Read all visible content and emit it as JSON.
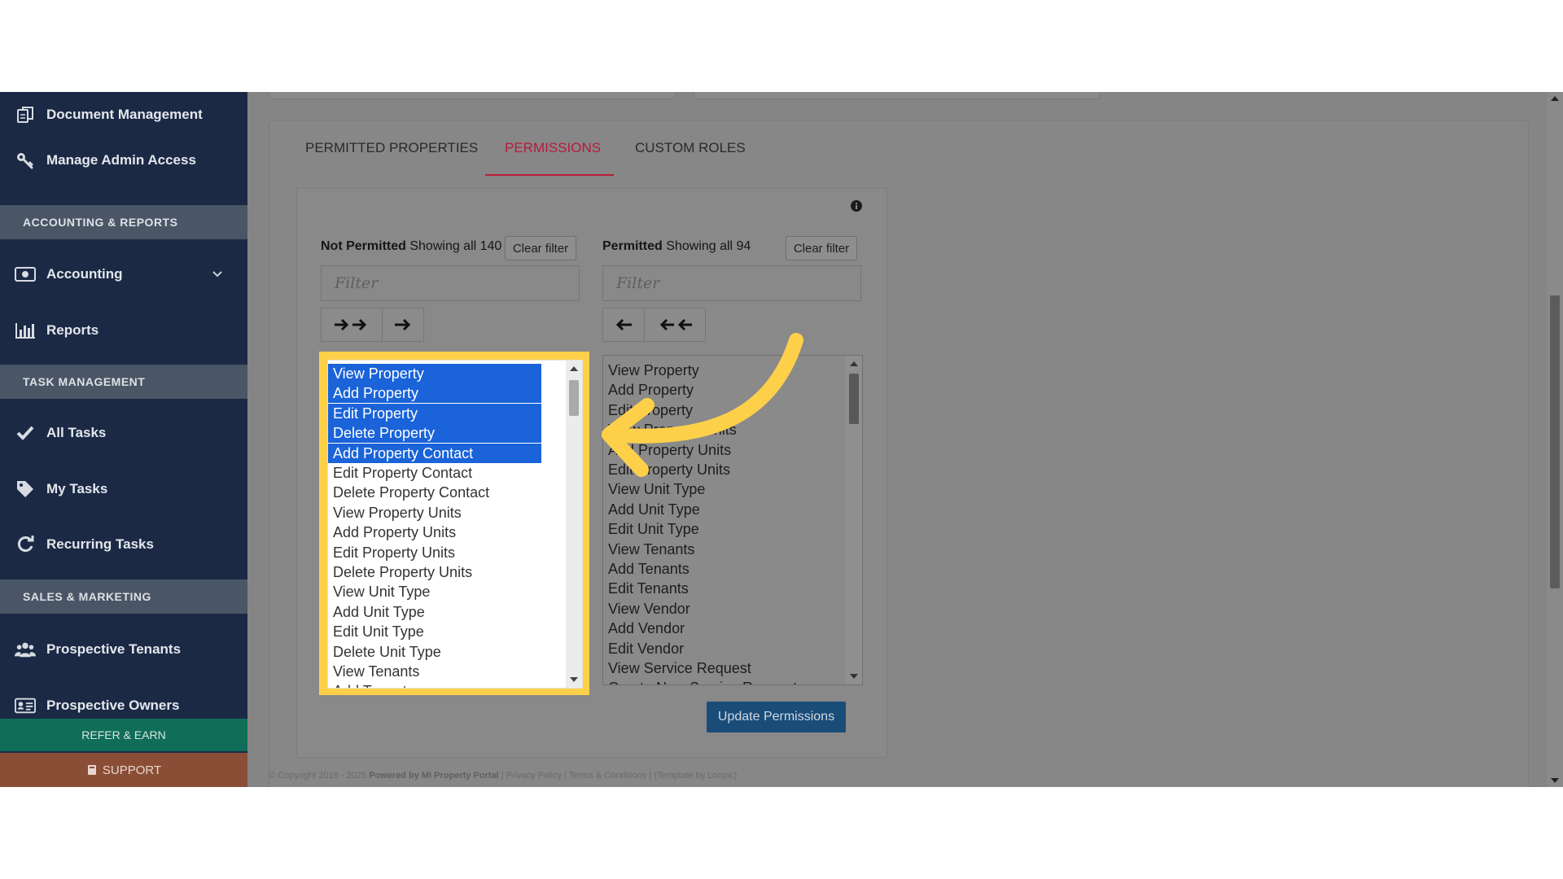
{
  "sidebar": {
    "items": [
      {
        "label": "Document Management",
        "icon": "documents-icon"
      },
      {
        "label": "Manage Admin Access",
        "icon": "key-icon"
      },
      {
        "label": "Accounting",
        "icon": "money-icon"
      },
      {
        "label": "Reports",
        "icon": "bar-chart-icon"
      },
      {
        "label": "All Tasks",
        "icon": "check-icon"
      },
      {
        "label": "My Tasks",
        "icon": "tag-icon"
      },
      {
        "label": "Recurring Tasks",
        "icon": "refresh-icon"
      },
      {
        "label": "Prospective Tenants",
        "icon": "users-icon"
      },
      {
        "label": "Prospective Owners",
        "icon": "id-card-icon"
      }
    ],
    "sections": [
      "ACCOUNTING & REPORTS",
      "TASK MANAGEMENT",
      "SALES & MARKETING"
    ],
    "refer_label": "REFER & EARN",
    "support_label": "SUPPORT"
  },
  "tabs": [
    "PERMITTED PROPERTIES",
    "PERMISSIONS",
    "CUSTOM ROLES"
  ],
  "not_permitted": {
    "title": "Not Permitted",
    "showing": "Showing all 140",
    "clear_label": "Clear filter",
    "filter_placeholder": "Filter",
    "items": [
      "View Property",
      "Add Property",
      "Edit Property",
      "Delete Property",
      "Add Property Contact",
      "Edit Property Contact",
      "Delete Property Contact",
      "View Property Units",
      "Add Property Units",
      "Edit Property Units",
      "Delete Property Units",
      "View Unit Type",
      "Add Unit Type",
      "Edit Unit Type",
      "Delete Unit Type",
      "View Tenants",
      "Add Tenants"
    ],
    "selected_count": 5
  },
  "permitted": {
    "title": "Permitted",
    "showing": "Showing all 94",
    "clear_label": "Clear filter",
    "filter_placeholder": "Filter",
    "items": [
      "View Property",
      "Add Property",
      "Edit Property",
      "View Property Units",
      "Add Property Units",
      "Edit Property Units",
      "View Unit Type",
      "Add Unit Type",
      "Edit Unit Type",
      "View Tenants",
      "Add Tenants",
      "Edit Tenants",
      "View Vendor",
      "Add Vendor",
      "Edit Vendor",
      "View Service Request",
      "Create New Service Request"
    ]
  },
  "update_label": "Update Permissions",
  "footer": {
    "copyright": "© Copyright 2016 - 2025",
    "powered": "Powered by MI Property Portal",
    "privacy": "Privacy Policy",
    "terms": "Terms & Conditions",
    "template": "(Template by Loopic)"
  },
  "colors": {
    "highlight": "#fed04a",
    "selection": "#1a63d9",
    "sidebar": "#1b2945",
    "active_tab": "#b71c3a"
  }
}
